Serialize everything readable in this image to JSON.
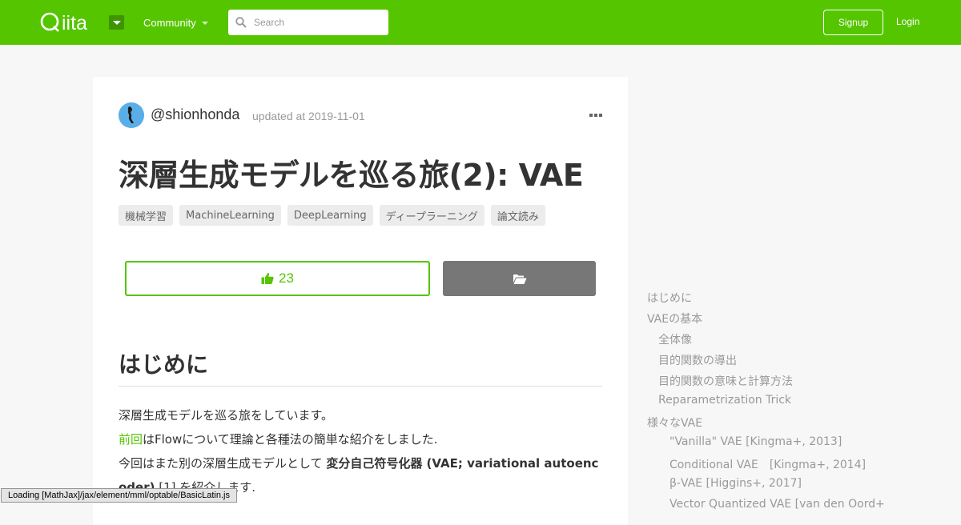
{
  "header": {
    "logo_text": "Qiita",
    "community_label": "Community",
    "search_placeholder": "Search",
    "signup_label": "Signup",
    "login_label": "Login",
    "brand_color": "#55c500"
  },
  "article": {
    "username": "@shionhonda",
    "updated": "updated at 2019-11-01",
    "title": "深層生成モデルを巡る旅(2): VAE",
    "tags": [
      "機械学習",
      "MachineLearning",
      "DeepLearning",
      "ディープラーニング",
      "論文読み"
    ],
    "like_count": "23",
    "section_heading": "はじめに",
    "paragraphs": {
      "p1": "深層生成モデルを巡る旅をしています。",
      "p2_link": "前回",
      "p2_rest": "はFlowについて理論と各種法の簡単な紹介をしました.",
      "p3_pre": "今回はまた別の深層生成モデルとして ",
      "p3_bold": "変分自己符号化器 (VAE; variational autoenc",
      "p4_bold": "oder)",
      "p4_rest": " [1] を紹介します."
    }
  },
  "toc": [
    {
      "label": "はじめに",
      "level": 0
    },
    {
      "label": "VAEの基本",
      "level": 0
    },
    {
      "label": "全体像",
      "level": 1
    },
    {
      "label": "目的関数の導出",
      "level": 1
    },
    {
      "label": "目的関数の意味と計算方法",
      "level": 1
    },
    {
      "label": "Reparametrization Trick",
      "level": 1
    },
    {
      "label": "様々なVAE",
      "level": 0
    },
    {
      "label": "\"Vanilla\" VAE [Kingma+, 2013]",
      "level": 2
    },
    {
      "label": "Conditional VAE　[Kingma+, 2014]",
      "level": 2
    },
    {
      "label": "β-VAE [Higgins+, 2017]",
      "level": 2
    },
    {
      "label": "Vector Quantized VAE [van den Oord+",
      "level": 2
    }
  ],
  "status_bar": "Loading [MathJax]/jax/element/mml/optable/BasicLatin.js"
}
